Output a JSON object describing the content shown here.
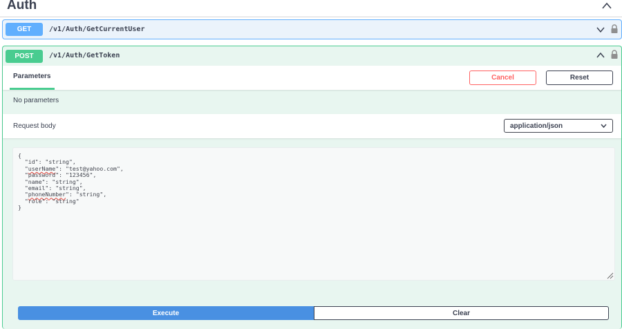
{
  "section": {
    "title": "Auth"
  },
  "operations": [
    {
      "method": "GET",
      "path": "/v1/Auth/GetCurrentUser",
      "color": "#61affe",
      "expanded": false
    },
    {
      "method": "POST",
      "path": "/v1/Auth/GetToken",
      "color": "#49cc90",
      "expanded": true
    }
  ],
  "try_it": {
    "tab_label": "Parameters",
    "cancel_label": "Cancel",
    "reset_label": "Reset",
    "no_parameters_text": "No parameters",
    "request_body_label": "Request body",
    "content_type": "application/json",
    "body_lines": [
      "{",
      "  \"id\": \"string\",",
      "  \"userName\": \"test@yahoo.com\",",
      "  \"password\": \"123456\",",
      "  \"name\": \"string\",",
      "  \"email\": \"string\",",
      "  \"phoneNumber\": \"string\",",
      "  \"role\": \"string\"",
      "}"
    ],
    "execute_label": "Execute",
    "clear_label": "Clear"
  },
  "icons": {
    "collapse_section": "chevron-up-icon",
    "expand_get": "chevron-down-icon",
    "collapse_post": "chevron-up-icon",
    "lock": "lock-icon",
    "select_arrow": "chevron-down-icon",
    "resize": "resize-grip-icon"
  }
}
